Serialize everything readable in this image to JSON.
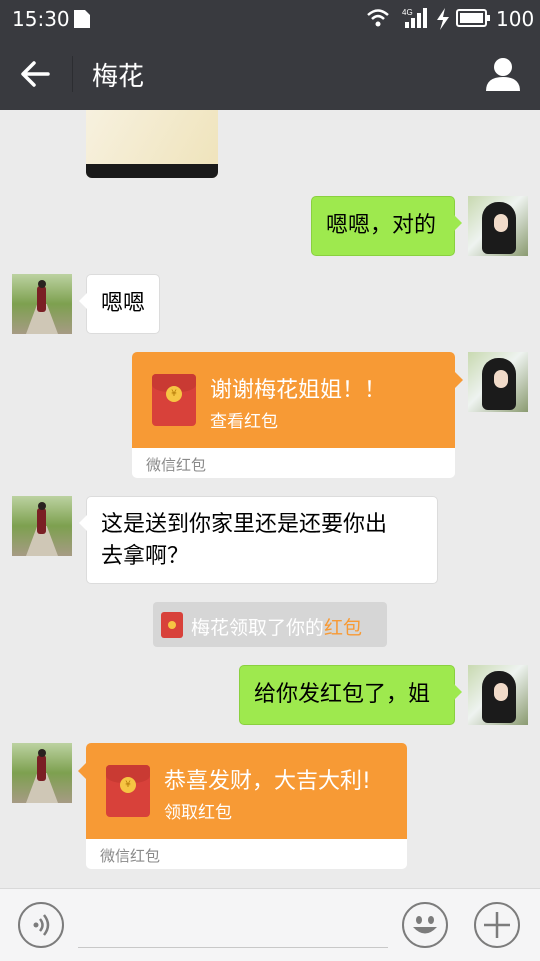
{
  "status_bar": {
    "time": "15:30",
    "network": "4G",
    "battery": "100"
  },
  "nav": {
    "title": "梅花"
  },
  "messages": {
    "m1": {
      "text": "嗯嗯，对的"
    },
    "m2": {
      "text": "嗯嗯"
    },
    "m3": {
      "title": "谢谢梅花姐姐！！",
      "action": "查看红包",
      "footer": "微信红包"
    },
    "m4": {
      "line1": "这是送到你家里还是还要你出",
      "line2": "去拿啊？"
    },
    "m5": {
      "prefix": "梅花领取了你的",
      "highlight": "红包"
    },
    "m6": {
      "text": "给你发红包了，姐"
    },
    "m7": {
      "title": "恭喜发财，大吉大利!",
      "action": "领取红包",
      "footer": "微信红包"
    }
  },
  "colors": {
    "nav_bg": "#393a3f",
    "chat_bg": "#ebebeb",
    "green_bubble": "#9ee94e",
    "red_packet": "#f79a35"
  }
}
